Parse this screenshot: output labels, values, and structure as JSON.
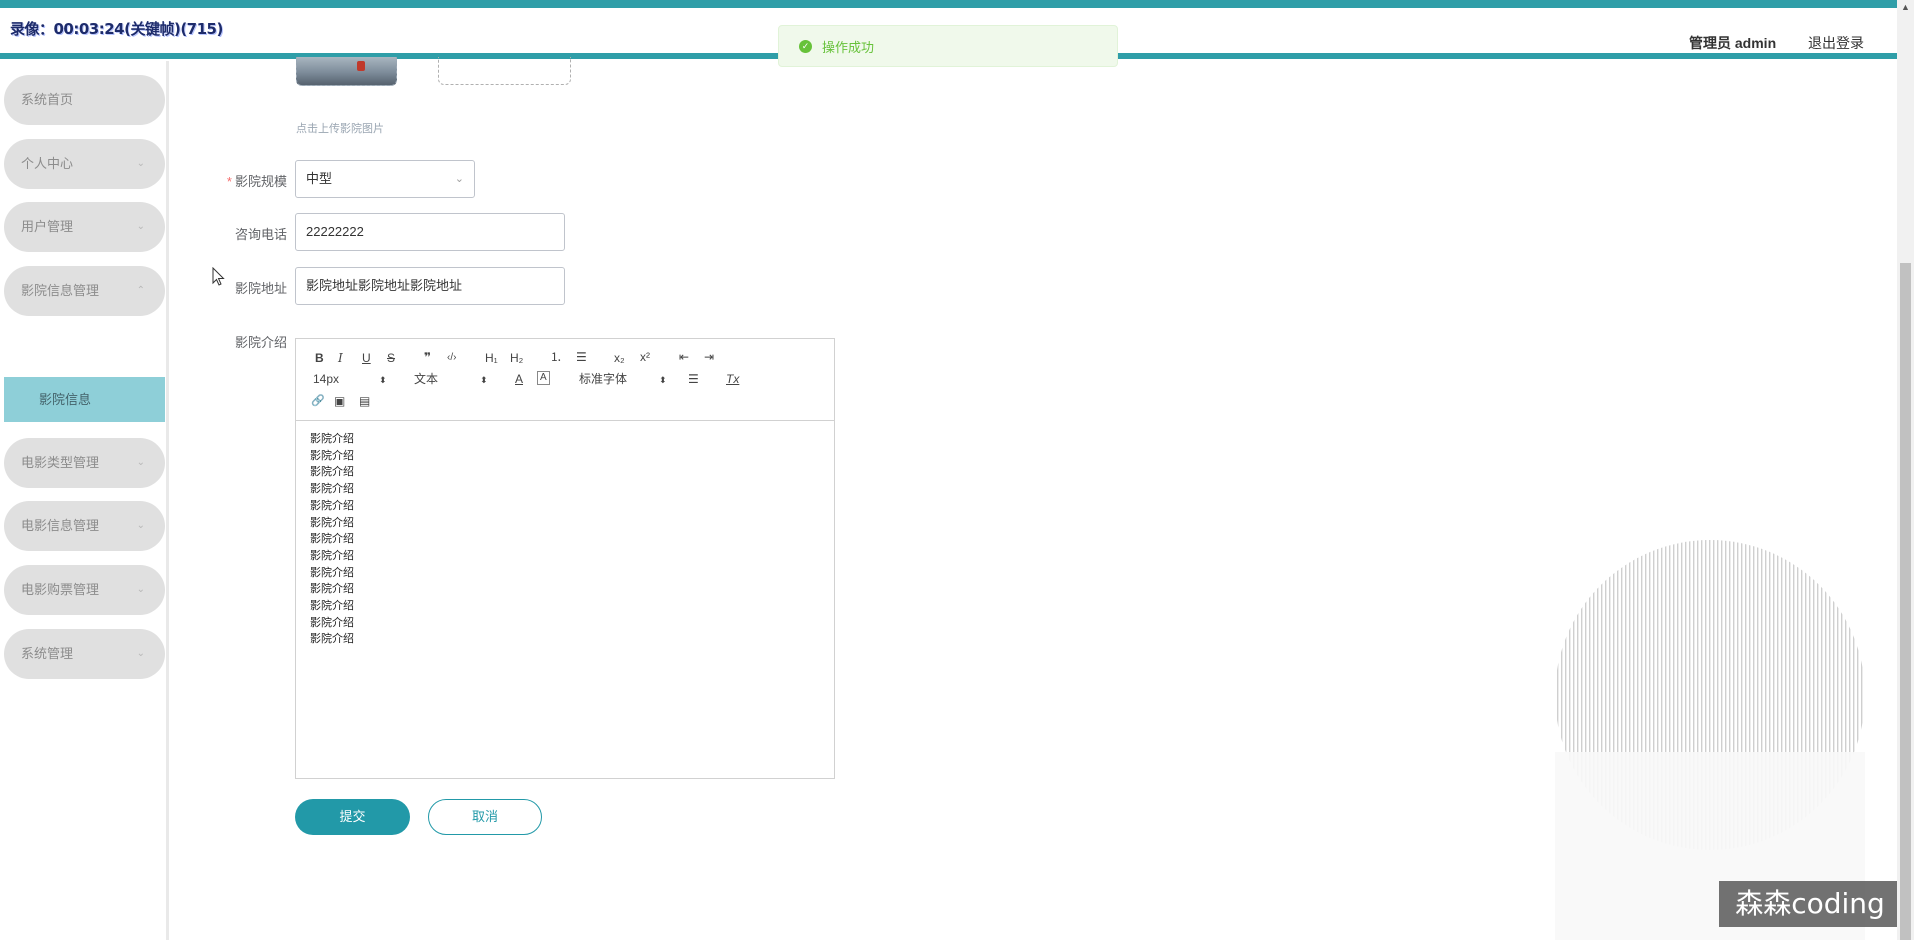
{
  "header": {
    "recorder_text": "录像：00:03:24(关键帧)(715)",
    "admin_label": "管理员 admin",
    "logout_label": "退出登录"
  },
  "toast": {
    "message": "操作成功",
    "icon": "check-circle-icon",
    "color": "#67c23a"
  },
  "sidebar": {
    "items": [
      {
        "label": "系统首页",
        "has_children": false
      },
      {
        "label": "个人中心",
        "has_children": true,
        "expanded": false
      },
      {
        "label": "用户管理",
        "has_children": true,
        "expanded": false
      },
      {
        "label": "影院信息管理",
        "has_children": true,
        "expanded": true
      },
      {
        "label": "电影类型管理",
        "has_children": true,
        "expanded": false
      },
      {
        "label": "电影信息管理",
        "has_children": true,
        "expanded": false
      },
      {
        "label": "电影购票管理",
        "has_children": true,
        "expanded": false
      },
      {
        "label": "系统管理",
        "has_children": true,
        "expanded": false
      }
    ],
    "active_subitem": "影院信息",
    "chevron_down": "⌄",
    "chevron_up": "⌃"
  },
  "form": {
    "upload_hint": "点击上传影院图片",
    "scale": {
      "label": "影院规模",
      "required": true,
      "value": "中型"
    },
    "phone": {
      "label": "咨询电话",
      "value": "22222222"
    },
    "address": {
      "label": "影院地址",
      "value": "影院地址影院地址影院地址"
    },
    "intro": {
      "label": "影院介绍"
    }
  },
  "editor": {
    "toolbar": {
      "bold": "B",
      "italic": "I",
      "underline": "U",
      "strike": "S",
      "quote": "❞",
      "code": "‹/›",
      "h1": "H₁",
      "h2": "H₂",
      "ordered_list": "⒈",
      "bullet_list": "☰",
      "subscript": "x₂",
      "superscript": "x²",
      "outdent": "⇤",
      "indent": "⇥",
      "font_size": "14px",
      "header_select": "文本",
      "font_family": "标准字体",
      "color": "A",
      "background": "A",
      "align": "☰",
      "clean": "Tx",
      "link": "🔗",
      "image": "▣",
      "video": "▤"
    },
    "content_lines": [
      "影院介绍",
      "影院介绍",
      "影院介绍",
      "影院介绍",
      "影院介绍",
      "影院介绍",
      "影院介绍",
      "影院介绍",
      "影院介绍",
      "影院介绍",
      "影院介绍",
      "影院介绍",
      "影院介绍"
    ]
  },
  "buttons": {
    "submit": "提交",
    "cancel": "取消"
  },
  "watermark": "森森coding",
  "colors": {
    "accent": "#2f9ea8",
    "button": "#2299a8",
    "submenu_active": "#8ecfd8",
    "menu_bg": "#e0e0e0"
  }
}
